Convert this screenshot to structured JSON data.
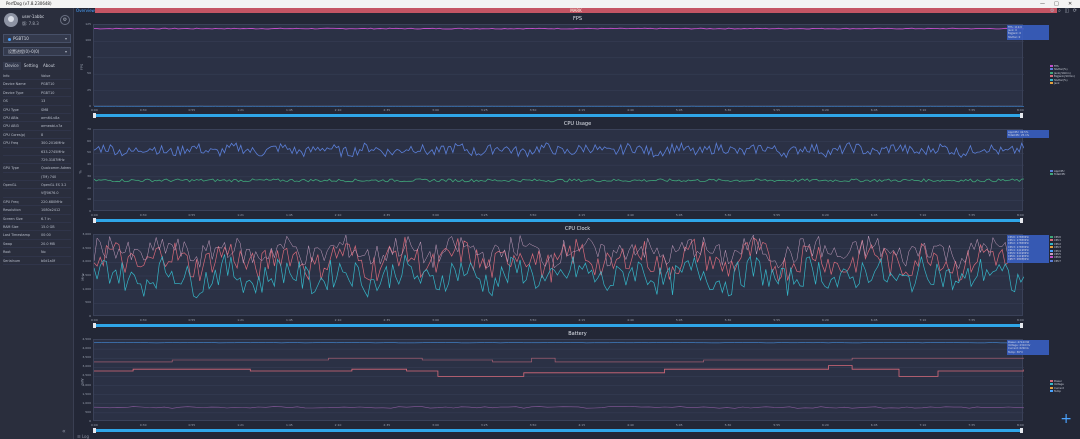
{
  "window": {
    "title": "PerfDog (v7.8.230648)",
    "controls": [
      "—",
      "□",
      "✕"
    ]
  },
  "sidebar": {
    "user_name": "user-1abbc",
    "user_sub": "版: 7.8.3",
    "device_select": "PGBT10",
    "app_select": "设置进程(0)-0(0)",
    "tabs": [
      "Device",
      "Setting",
      "About"
    ],
    "info_rows": [
      {
        "k": "Info",
        "v": "Value"
      },
      {
        "k": "Device Name",
        "v": "PGBT10"
      },
      {
        "k": "Device Type",
        "v": "PGBT10"
      },
      {
        "k": "OS",
        "v": "13"
      },
      {
        "k": "CPU Type",
        "v": "SM8"
      },
      {
        "k": "CPU ABIs",
        "v": "arm64-v8a"
      },
      {
        "k": "CPU ABI3",
        "v": "armeabi-v7a"
      },
      {
        "k": "CPU Cores(p)",
        "v": "8"
      },
      {
        "k": "CPU Freq",
        "v": "300-2016MHz"
      },
      {
        "k": "",
        "v": "633-2745MHz"
      },
      {
        "k": "",
        "v": "729-3187MHz"
      },
      {
        "k": "GPU Type",
        "v": "Qualcomm Adreno"
      },
      {
        "k": "",
        "v": "(TM) 740"
      },
      {
        "k": "OpenGL",
        "v": "OpenGL ES 3.2"
      },
      {
        "k": "",
        "v": "V@0676.0"
      },
      {
        "k": "GPU Freq",
        "v": "220-680MHz"
      },
      {
        "k": "Resolution",
        "v": "1080x2412"
      },
      {
        "k": "Screen Size",
        "v": "6.7 in"
      },
      {
        "k": "RAM Size",
        "v": "15.0 GB"
      },
      {
        "k": "Last Timestamp",
        "v": "00:00"
      },
      {
        "k": "Swap",
        "v": "20.0 MB"
      },
      {
        "k": "Root",
        "v": "No"
      },
      {
        "k": "Serialnum",
        "v": "b0d1a0f"
      }
    ],
    "collapse": "«"
  },
  "main": {
    "top_tab": "Overview",
    "banner": "MARK",
    "top_icons": "⚙ ⌕ ◫ ⟳",
    "footer": "☰ Log"
  },
  "colors": {
    "fps": "#c24fc9",
    "cpu_app": "#5b7fd8",
    "cpu_total": "#3fa67a",
    "clock_a": "#d86a7a",
    "clock_b": "#35b6c8",
    "battery_a": "#d86a7a",
    "battery_b": "#8a5a9e"
  },
  "x_ticks": [
    "0:00",
    "0:30",
    "0:55",
    "1:21",
    "1:45",
    "2:10",
    "2:35",
    "3:00",
    "3:25",
    "3:50",
    "4:15",
    "4:40",
    "5:05",
    "5:30",
    "5:55",
    "6:20",
    "6:45",
    "7:10",
    "7:35",
    "8:00"
  ],
  "panels": [
    {
      "title": "FPS",
      "y_axis": "FPS",
      "y_ticks": [
        "125",
        "100",
        "75",
        "50",
        "25",
        "0"
      ],
      "legend": [
        "FPS",
        "Stutter(%)",
        "Jank(/10min)",
        "BigJank(/10min)",
        "Stutter(%)",
        "Jank"
      ],
      "tooltip": [
        "FPS: 119.9",
        "Jank: 0",
        "BigJank: 0",
        "Stutter: 0"
      ]
    },
    {
      "title": "CPU Usage",
      "y_axis": "%",
      "y_ticks": [
        "70",
        "60",
        "50",
        "40",
        "30",
        "20",
        "10",
        "0"
      ],
      "legend": [
        "AppCPU",
        "TotalCPU"
      ],
      "tooltip": [
        "AppCPU: 42.5%",
        "TotalCPU: 25.1%"
      ]
    },
    {
      "title": "CPU Clock",
      "y_axis": "MHz",
      "y_ticks": [
        "3,000",
        "2,500",
        "2,000",
        "1,500",
        "1,000",
        "500",
        "0"
      ],
      "legend": [
        "CPU0",
        "CPU1",
        "CPU2",
        "CPU3",
        "CPU4",
        "CPU5",
        "CPU6",
        "CPU7"
      ],
      "tooltip": [
        "CPU0: 1785MHz",
        "CPU1: 1785MHz",
        "CPU2: 1785MHz",
        "CPU3: 1785MHz",
        "CPU4: 2419MHz",
        "CPU5: 2419MHz",
        "CPU6: 2419MHz",
        "CPU7: 2803MHz"
      ]
    },
    {
      "title": "Battery",
      "y_axis": "mW",
      "y_ticks": [
        "4,500",
        "4,000",
        "3,500",
        "3,000",
        "2,500",
        "2,000",
        "1,500",
        "1,000",
        "500",
        "0"
      ],
      "legend": [
        "Power",
        "Voltage",
        "Current",
        "Temp"
      ],
      "tooltip": [
        "Power: 2712mW",
        "Voltage: 4310mV",
        "Current: 629mA",
        "Temp: 36°C"
      ]
    }
  ]
}
